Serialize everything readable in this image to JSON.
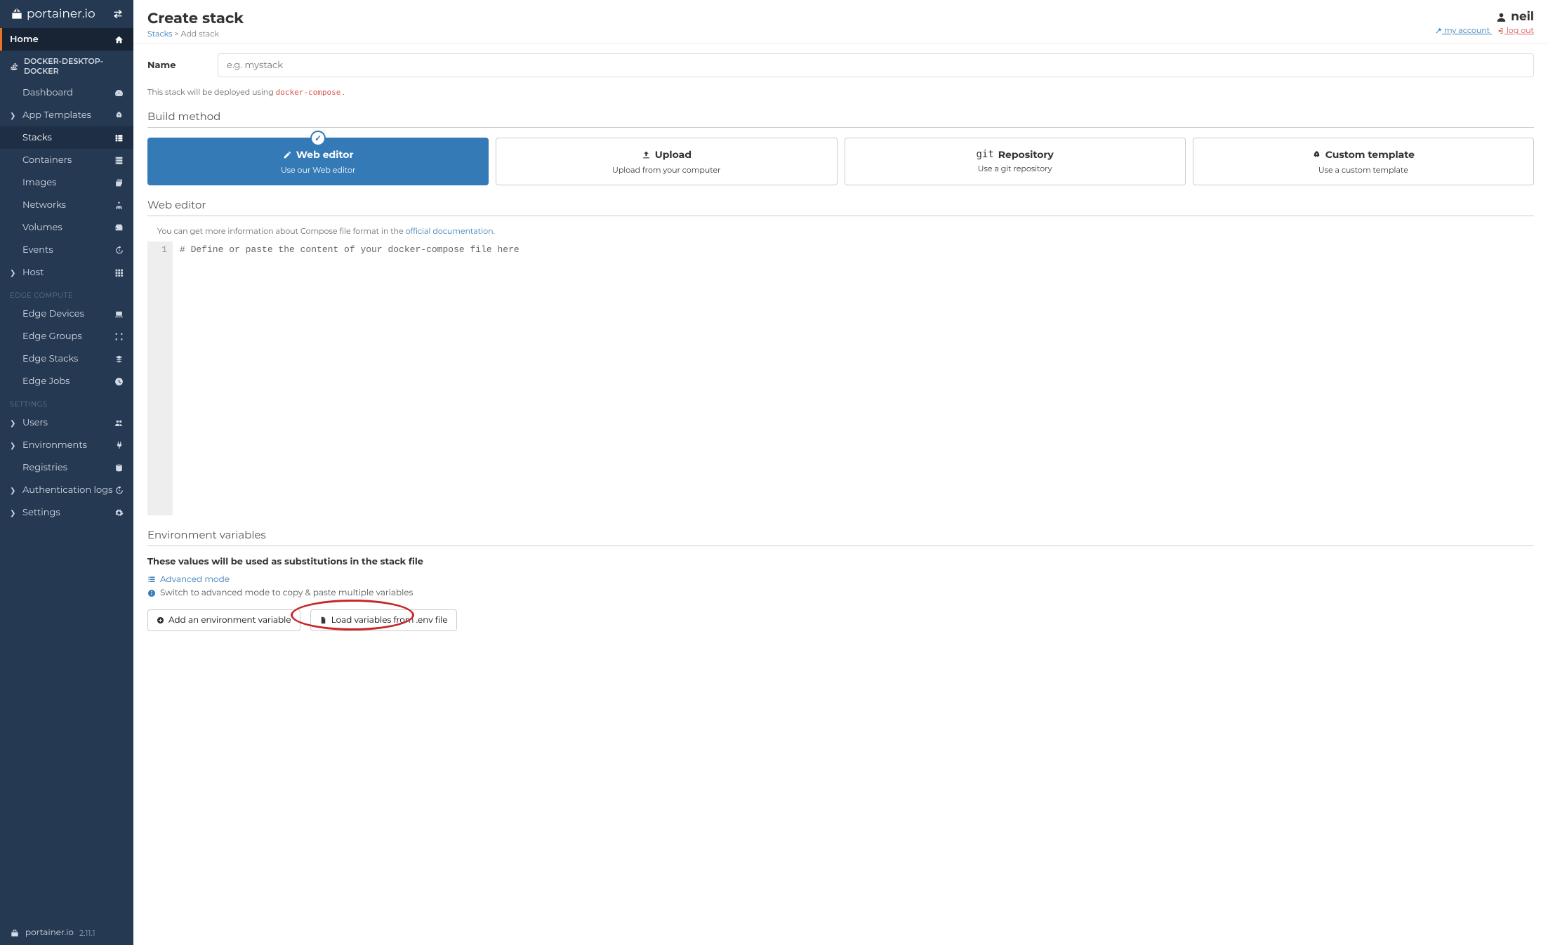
{
  "brand": "portainer.io",
  "header": {
    "title": "Create stack",
    "breadcrumb_parent": "Stacks",
    "breadcrumb_sep": " > ",
    "breadcrumb_current": "Add stack",
    "user": "neil",
    "my_account": "my account",
    "logout": "log out"
  },
  "sidebar": {
    "home": "Home",
    "endpoint": "DOCKER-DESKTOP-DOCKER",
    "items_env": [
      {
        "label": "Dashboard",
        "icon": "tachometer"
      },
      {
        "label": "App Templates",
        "icon": "rocket",
        "caret": true
      },
      {
        "label": "Stacks",
        "icon": "th-list",
        "active": true
      },
      {
        "label": "Containers",
        "icon": "server"
      },
      {
        "label": "Images",
        "icon": "clone"
      },
      {
        "label": "Networks",
        "icon": "sitemap"
      },
      {
        "label": "Volumes",
        "icon": "hdd"
      },
      {
        "label": "Events",
        "icon": "history"
      },
      {
        "label": "Host",
        "icon": "th",
        "caret": true
      }
    ],
    "section_edge": "EDGE COMPUTE",
    "items_edge": [
      {
        "label": "Edge Devices",
        "icon": "laptop"
      },
      {
        "label": "Edge Groups",
        "icon": "object-group"
      },
      {
        "label": "Edge Stacks",
        "icon": "layer-group"
      },
      {
        "label": "Edge Jobs",
        "icon": "clock"
      }
    ],
    "section_settings": "SETTINGS",
    "items_settings": [
      {
        "label": "Users",
        "icon": "users",
        "caret": true
      },
      {
        "label": "Environments",
        "icon": "plug",
        "caret": true
      },
      {
        "label": "Registries",
        "icon": "database"
      },
      {
        "label": "Authentication logs",
        "icon": "history",
        "caret": true
      },
      {
        "label": "Settings",
        "icon": "cogs",
        "caret": true
      }
    ],
    "footer_brand": "portainer.io",
    "version": "2.11.1"
  },
  "form": {
    "name_label": "Name",
    "name_placeholder": "e.g. mystack",
    "deploy_note_prefix": "This stack will be deployed using ",
    "deploy_note_cmd": "docker-compose",
    "section_build": "Build method",
    "build_options": [
      {
        "title": "Web editor",
        "sub": "Use our Web editor",
        "icon": "edit",
        "active": true
      },
      {
        "title": "Upload",
        "sub": "Upload from your computer",
        "icon": "upload"
      },
      {
        "title": "Repository",
        "sub": "Use a git repository",
        "icon": "git"
      },
      {
        "title": "Custom template",
        "sub": "Use a custom template",
        "icon": "rocket"
      }
    ],
    "section_editor": "Web editor",
    "editor_info_prefix": "You can get more information about Compose file format in the ",
    "editor_info_link": "official documentation",
    "editor_line": "1",
    "editor_content": "# Define or paste the content of your docker-compose file here",
    "section_env": "Environment variables",
    "env_desc": "These values will be used as substitutions in the stack file",
    "advanced_mode": "Advanced mode",
    "advanced_note": "Switch to advanced mode to copy & paste multiple variables",
    "btn_add_env": "Add an environment variable",
    "btn_load_env": "Load variables from .env file"
  }
}
